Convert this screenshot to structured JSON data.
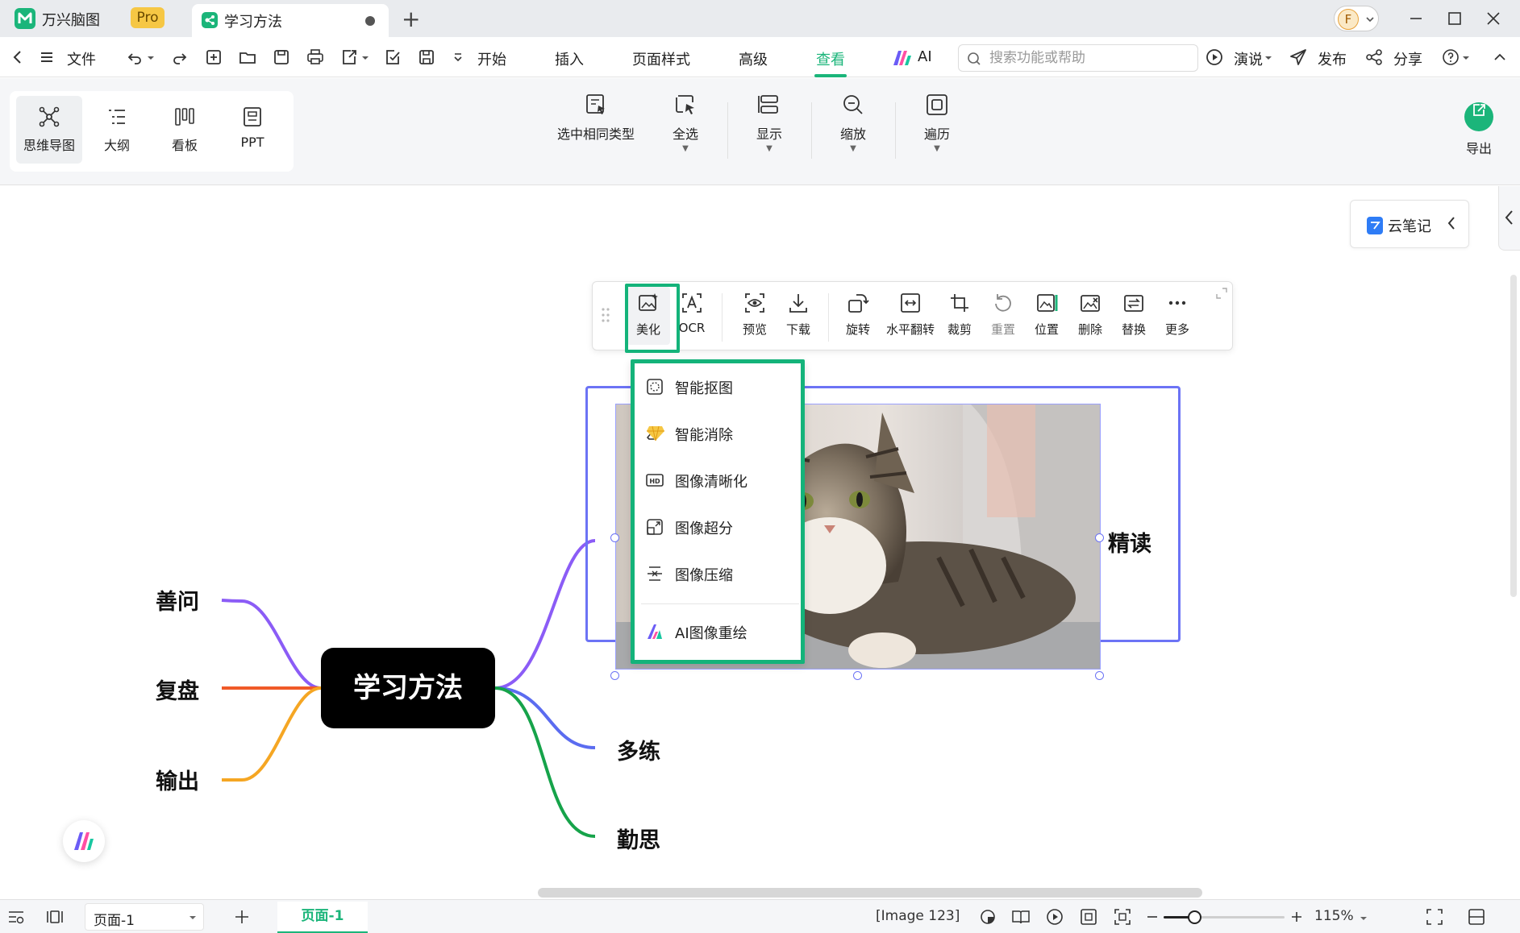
{
  "app": {
    "name": "万兴脑图",
    "badge": "Pro",
    "doc_title": "学习方法",
    "avatar_letter": "F"
  },
  "menubar": {
    "file": "文件",
    "tabs": [
      "开始",
      "插入",
      "页面样式",
      "高级",
      "查看",
      "AI"
    ],
    "active_tab": "查看",
    "search_placeholder": "搜索功能或帮助",
    "present": "演说",
    "publish": "发布",
    "share": "分享"
  },
  "ribbon": {
    "views": [
      "思维导图",
      "大纲",
      "看板",
      "PPT"
    ],
    "active_view": "思维导图",
    "buttons": [
      "选中相同类型",
      "全选",
      "显示",
      "缩放",
      "遍历"
    ],
    "export": "导出"
  },
  "canvas": {
    "cloud_note": "云笔记",
    "root": "学习方法",
    "left_nodes": [
      "善问",
      "复盘",
      "输出"
    ],
    "right_nodes": [
      "精读",
      "多练",
      "勤思"
    ],
    "branch_colors": {
      "shanwen": "#8b5cf6",
      "fupan": "#f05a28",
      "shuchu": "#f5a623",
      "jingdu": "#8b5cf6",
      "duolian": "#5b6cf0",
      "qinsi": "#16a34a"
    }
  },
  "image_toolbar": {
    "items": [
      "美化",
      "OCR",
      "预览",
      "下载",
      "旋转",
      "水平翻转",
      "裁剪",
      "重置",
      "位置",
      "删除",
      "替换",
      "更多"
    ],
    "highlighted": "美化",
    "disabled": [
      "重置"
    ]
  },
  "beautify_menu": {
    "items": [
      "智能抠图",
      "智能消除",
      "图像清晰化",
      "图像超分",
      "图像压缩",
      "AI图像重绘"
    ],
    "vip_item": "智能消除"
  },
  "statusbar": {
    "page_select": "页面-1",
    "page_tab": "页面-1",
    "selection_info": "[Image 123]",
    "zoom": "115%",
    "zoom_fraction": 0.25
  },
  "colors": {
    "accent": "#1bb57a",
    "selection": "#6c73f5",
    "highlight": "#14b37a"
  }
}
